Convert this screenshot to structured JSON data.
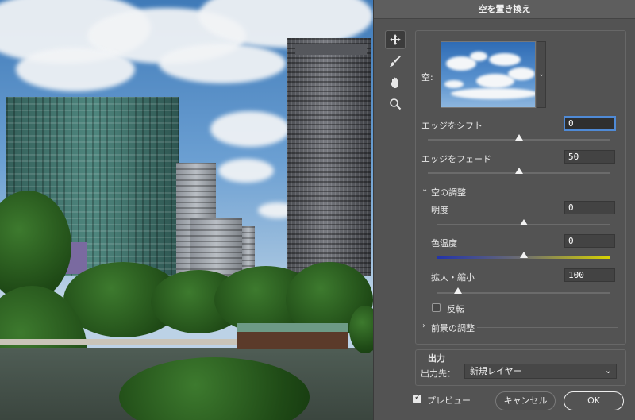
{
  "dialog": {
    "title": "空を置き換え",
    "sky_label": "空:",
    "shift_edge": {
      "label": "エッジをシフト",
      "value": "0",
      "slider": 0.5
    },
    "fade_edge": {
      "label": "エッジをフェード",
      "value": "50",
      "slider": 0.5
    },
    "sky_adjust": {
      "heading": "空の調整",
      "brightness": {
        "label": "明度",
        "value": "0",
        "slider": 0.5
      },
      "temperature": {
        "label": "色温度",
        "value": "0",
        "slider": 0.5
      },
      "scale": {
        "label": "拡大・縮小",
        "value": "100",
        "slider": 0.12
      },
      "flip_label": "反転",
      "flip_checked": false
    },
    "foreground_adjust": {
      "heading": "前景の調整"
    },
    "output": {
      "heading": "出力",
      "dest_label": "出力先：",
      "dest_value": "新規レイヤー"
    },
    "preview": {
      "label": "プレビュー",
      "checked": true
    },
    "buttons": {
      "cancel": "キャンセル",
      "ok": "OK"
    },
    "tools": [
      "move-icon",
      "brush-icon",
      "hand-icon",
      "zoom-icon"
    ]
  }
}
